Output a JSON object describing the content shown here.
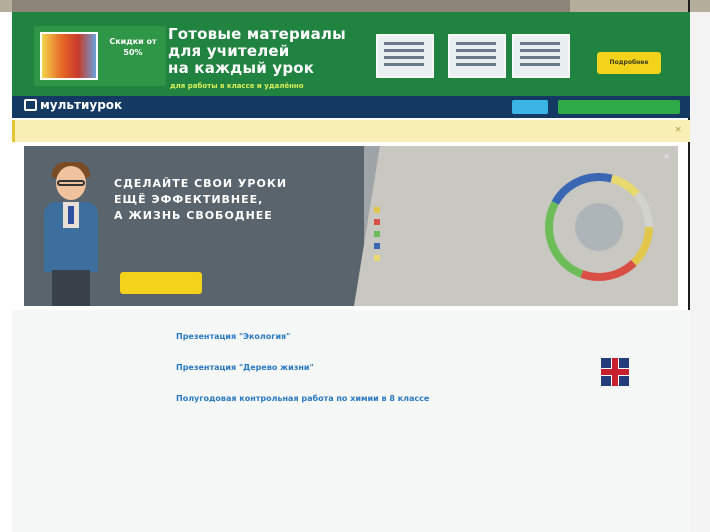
{
  "banner": {
    "promo": "Скидки от 50%",
    "title_line1": "Готовые материалы",
    "title_line2": "для учителей",
    "title_line3": "на каждый урок",
    "subtitle": "для работы в классе и удалённо",
    "thumb_caps": [
      "",
      "",
      ""
    ],
    "cta": "Подробнее"
  },
  "nav": {
    "logo": "мультиурок",
    "links": [
      "",
      "",
      "",
      ""
    ],
    "btn1": "",
    "btn2": ""
  },
  "notice": {
    "text": ""
  },
  "hero": {
    "title_line1": "СДЕЛАЙТЕ СВОИ УРОКИ",
    "title_line2": "ЕЩЁ ЭФФЕКТИВНЕЕ,",
    "title_line3": "А ЖИЗНЬ СВОБОДНЕЕ",
    "desc": "",
    "button": "",
    "small_text": "",
    "right_title": "",
    "list": [
      {
        "label": "",
        "color": "#e1c84d"
      },
      {
        "label": "",
        "color": "#d94f45"
      },
      {
        "label": "",
        "color": "#6cbd58"
      },
      {
        "label": "",
        "color": "#3a67b3"
      },
      {
        "label": "",
        "color": "#e8d870"
      }
    ],
    "donut_number": "",
    "donut_unit": "",
    "note": ""
  },
  "sidebar": {
    "header": "",
    "name": "",
    "role": "",
    "stats": [
      "",
      ""
    ],
    "kv": [
      {
        "k": "",
        "v": ""
      },
      {
        "k": "",
        "v": ""
      }
    ],
    "section1": "",
    "section1_sub": "",
    "section2": ""
  },
  "main": {
    "tabs": [
      "",
      "",
      "",
      "",
      "",
      "",
      ""
    ],
    "items": [
      {
        "title": "Презентация \"Экология\"",
        "desc": "",
        "meta": ""
      },
      {
        "title": "Презентация \"Дерево жизни\"",
        "desc": "",
        "meta": ""
      },
      {
        "title": "Полугодовая контрольная работа по химии в 8 классе",
        "desc": "",
        "meta": ""
      }
    ]
  },
  "rightcol": {
    "title": "",
    "lines": [
      "",
      "",
      ""
    ],
    "course": ""
  },
  "colors": {
    "banner_green": "#218340",
    "nav_blue": "#143a63",
    "accent_yellow": "#f2d21b",
    "link_blue": "#2a7ac3"
  }
}
